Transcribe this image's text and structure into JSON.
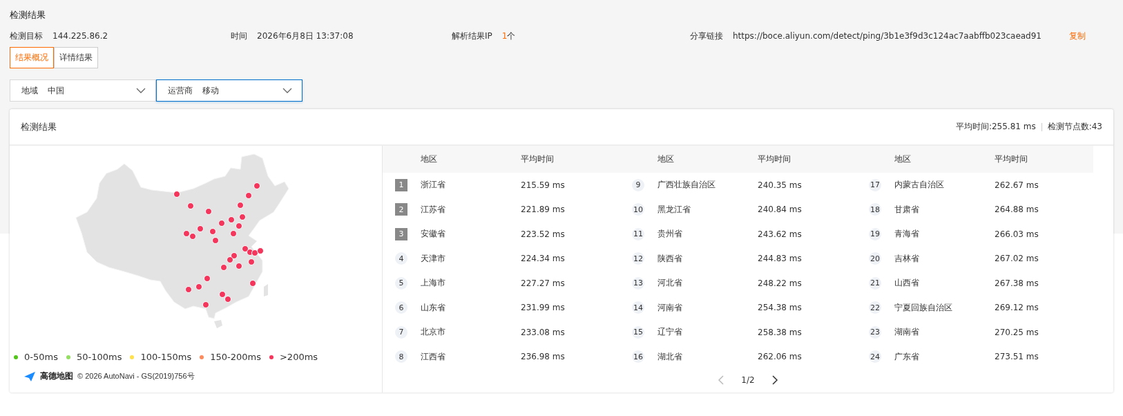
{
  "page_title": "检测结果",
  "info": [
    {
      "label": "检测目标",
      "value": "144.225.86.2",
      "kind": "plain"
    },
    {
      "label": "时间",
      "value": "2026年6月8日 13:37:08",
      "kind": "plain"
    },
    {
      "label": "解析结果IP",
      "value": "1",
      "suffix": "个",
      "kind": "count"
    },
    {
      "label": "分享链接",
      "value": "https://boce.aliyun.com/detect/ping/3b1e3f9d3c124ac7aabffb023caead91",
      "action": "复制",
      "kind": "link"
    }
  ],
  "tabs": [
    {
      "label": "结果概况",
      "selected": true
    },
    {
      "label": "详情结果",
      "selected": false
    }
  ],
  "filters": [
    {
      "label": "地域",
      "value": "中国",
      "focused": false
    },
    {
      "label": "运营商",
      "value": "移动",
      "focused": true
    }
  ],
  "card": {
    "title": "检测结果",
    "avg_time": "平均时间:255.81 ms",
    "node_count": "检测节点数:43",
    "legend": [
      {
        "label": "0-50ms",
        "color": "#52c41a"
      },
      {
        "label": "50-100ms",
        "color": "#95de64"
      },
      {
        "label": "100-150ms",
        "color": "#ffe14d"
      },
      {
        "label": "150-200ms",
        "color": "#ff8a5c"
      },
      {
        "label": ">200ms",
        "color": "#f5365c"
      }
    ],
    "map_brand": "高德地图",
    "map_copyright": "© 2026 AutoNavi - GS(2019)756号",
    "table": {
      "columns": [
        "地区",
        "平均时间",
        "地区",
        "平均时间",
        "地区",
        "平均时间"
      ],
      "rows": [
        {
          "rank": "1",
          "kind": "top",
          "region": "浙江省",
          "time": "215.59 ms"
        },
        {
          "rank": "2",
          "kind": "top",
          "region": "江苏省",
          "time": "221.89 ms"
        },
        {
          "rank": "3",
          "kind": "top",
          "region": "安徽省",
          "time": "223.52 ms"
        },
        {
          "rank": "4",
          "kind": "normal",
          "region": "天津市",
          "time": "224.34 ms"
        },
        {
          "rank": "5",
          "kind": "normal",
          "region": "上海市",
          "time": "227.27 ms"
        },
        {
          "rank": "6",
          "kind": "normal",
          "region": "山东省",
          "time": "231.99 ms"
        },
        {
          "rank": "7",
          "kind": "normal",
          "region": "北京市",
          "time": "233.08 ms"
        },
        {
          "rank": "8",
          "kind": "normal",
          "region": "江西省",
          "time": "236.98 ms"
        },
        {
          "rank": "9",
          "kind": "normal",
          "region": "广西壮族自治区",
          "time": "240.35 ms"
        },
        {
          "rank": "10",
          "kind": "normal",
          "region": "黑龙江省",
          "time": "240.84 ms"
        },
        {
          "rank": "11",
          "kind": "normal",
          "region": "贵州省",
          "time": "243.62 ms"
        },
        {
          "rank": "12",
          "kind": "normal",
          "region": "陕西省",
          "time": "244.83 ms"
        },
        {
          "rank": "13",
          "kind": "normal",
          "region": "河北省",
          "time": "248.22 ms"
        },
        {
          "rank": "14",
          "kind": "normal",
          "region": "河南省",
          "time": "254.38 ms"
        },
        {
          "rank": "15",
          "kind": "normal",
          "region": "辽宁省",
          "time": "258.38 ms"
        },
        {
          "rank": "16",
          "kind": "normal",
          "region": "湖北省",
          "time": "262.06 ms"
        },
        {
          "rank": "17",
          "kind": "normal",
          "region": "内蒙古自治区",
          "time": "262.67 ms"
        },
        {
          "rank": "18",
          "kind": "normal",
          "region": "甘肃省",
          "time": "264.88 ms"
        },
        {
          "rank": "19",
          "kind": "normal",
          "region": "青海省",
          "time": "266.03 ms"
        },
        {
          "rank": "20",
          "kind": "normal",
          "region": "吉林省",
          "time": "267.02 ms"
        },
        {
          "rank": "21",
          "kind": "normal",
          "region": "山西省",
          "time": "267.38 ms"
        },
        {
          "rank": "22",
          "kind": "normal",
          "region": "宁夏回族自治区",
          "time": "269.12 ms"
        },
        {
          "rank": "23",
          "kind": "normal",
          "region": "湖南省",
          "time": "270.25 ms"
        },
        {
          "rank": "24",
          "kind": "normal",
          "region": "广东省",
          "time": "273.51 ms"
        }
      ]
    },
    "pagination": "1/2"
  }
}
